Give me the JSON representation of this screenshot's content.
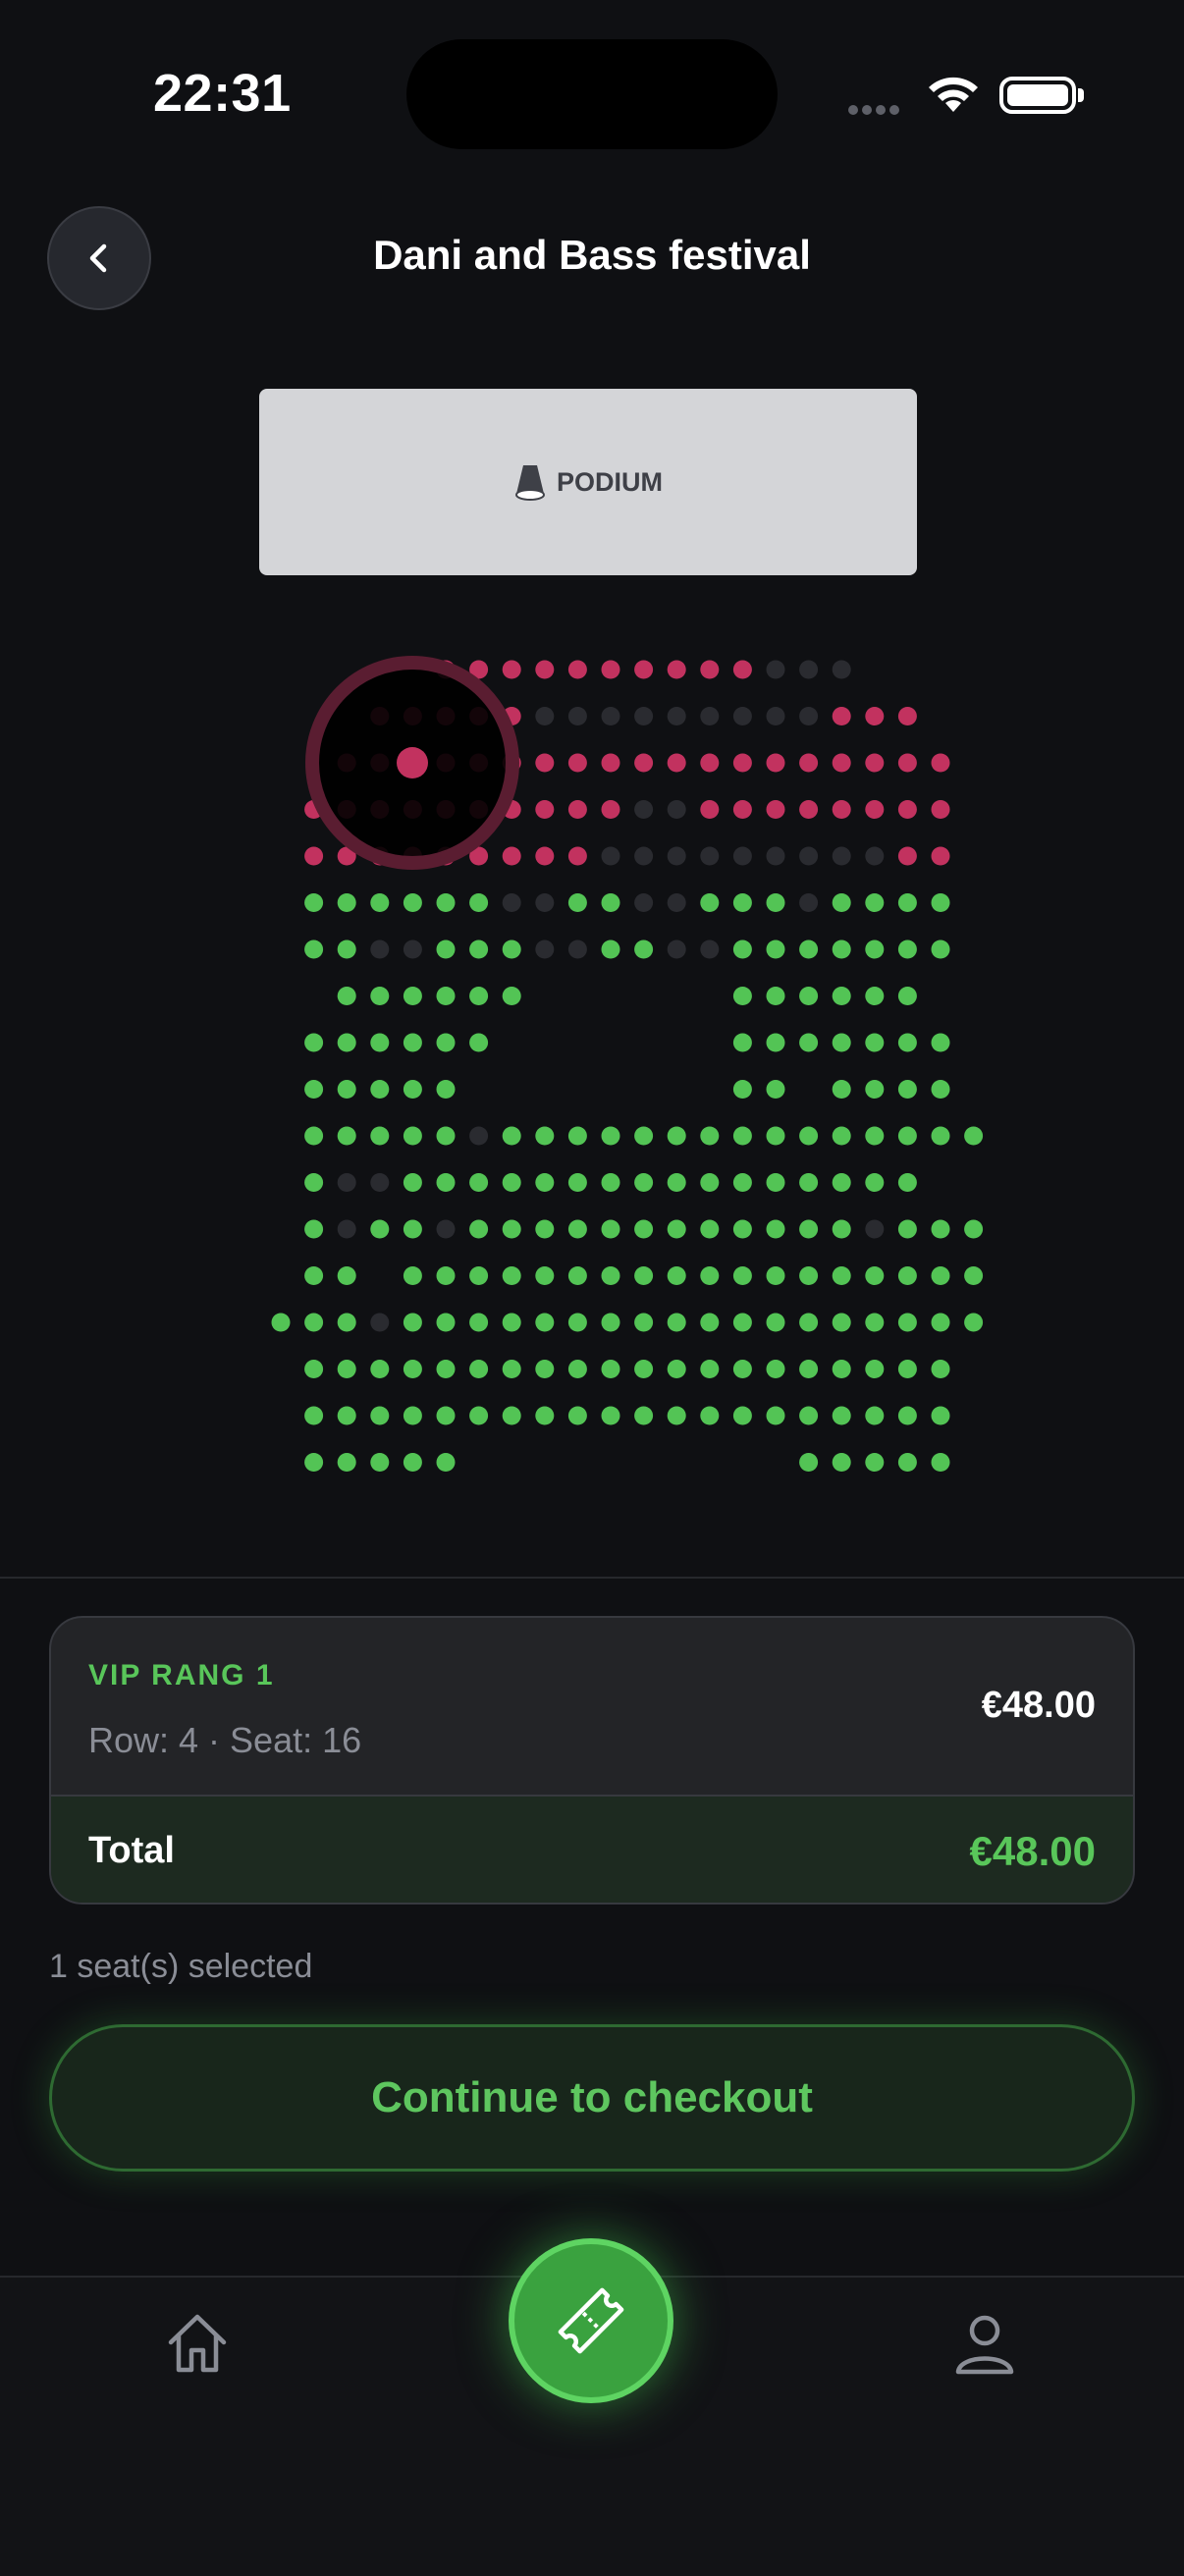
{
  "status_bar": {
    "time": "22:31",
    "wifi_icon": "wifi-icon",
    "battery_icon": "battery-icon"
  },
  "header": {
    "title": "Dani and Bass festival",
    "back_icon": "chevron-left-icon"
  },
  "stage": {
    "label": "PODIUM",
    "icon": "spotlight-icon"
  },
  "seat_map": {
    "colors": {
      "vip": "#c2325f",
      "regular": "#53c455",
      "unavailable": "#2a2b30",
      "selected": "#c2325f"
    },
    "legend_note": "p = pink available seat, g = green available seat, . = unavailable seat, space = no seat",
    "rows": [
      "   pppppppppp...   ",
      "ppppp.........ppp",
      "ppppppppppppppppppp",
      "pppppppppp..pppppppp",
      "ppppppppp.........pp",
      "gggggg..gg..ggg.gggg",
      "gg..ggg..gg..ggggggg",
      " gggggg      gggggg ",
      "gggggg       ggggggg",
      "ggggg        gg gggg",
      "ggggg.ggggggggggggggg",
      "g..gggggggggggggggg ",
      "g.gg.gggggggggggg.ggg",
      "gg gggggggggggggggggg",
      "ggg.gggggggggggggggggg",
      "gggggggggggggggggggg",
      "gggggggggggggggggggg",
      "ggggg          ggggg"
    ],
    "selected_seat": {
      "row": 4,
      "seat": 16
    }
  },
  "summary": {
    "tier": "VIP RANG 1",
    "row_seat": "Row: 4 · Seat: 16",
    "price": "€48.00",
    "total_label": "Total",
    "total_value": "€48.00"
  },
  "selection_count": "1 seat(s) selected",
  "checkout_button": "Continue to checkout",
  "tab_bar": {
    "items": [
      {
        "icon": "home-icon"
      },
      {
        "icon": "ticket-icon"
      },
      {
        "icon": "profile-icon"
      }
    ]
  }
}
